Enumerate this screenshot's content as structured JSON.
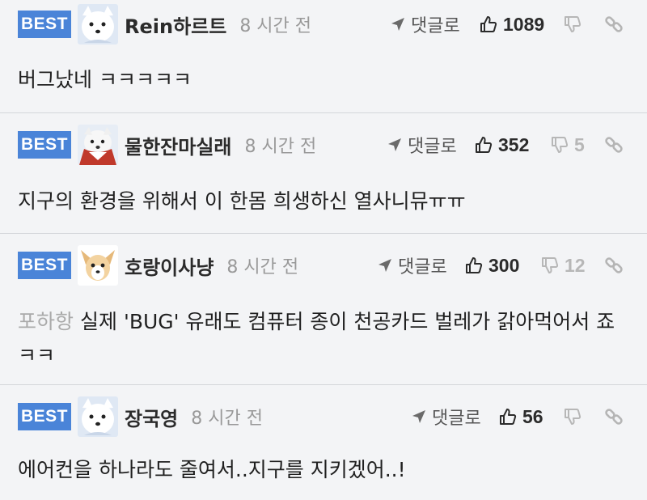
{
  "comments": [
    {
      "badge": "BEST",
      "avatar": "white-dog-avatar",
      "nickname": "Rein하르트",
      "time": "8 시간 전",
      "reply_label": "댓글로",
      "upvotes": "1089",
      "downvotes": "",
      "mention": "",
      "text": "버그났네 ㅋㅋㅋㅋㅋ"
    },
    {
      "badge": "BEST",
      "avatar": "dog-red-cape-avatar",
      "nickname": "물한잔마실래",
      "time": "8 시간 전",
      "reply_label": "댓글로",
      "upvotes": "352",
      "downvotes": "5",
      "mention": "",
      "text": "지구의 환경을 위해서 이 한몸 희생하신 열사니뮤ㅠㅠ"
    },
    {
      "badge": "BEST",
      "avatar": "chihuahua-avatar",
      "nickname": "호랑이사냥",
      "time": "8 시간 전",
      "reply_label": "댓글로",
      "upvotes": "300",
      "downvotes": "12",
      "mention": "포하항",
      "text": "실제 'BUG' 유래도 컴퓨터 종이 천공카드 벌레가 갉아먹어서 죠 ㅋㅋ"
    },
    {
      "badge": "BEST",
      "avatar": "white-dog-avatar",
      "nickname": "장국영",
      "time": "8 시간 전",
      "reply_label": "댓글로",
      "upvotes": "56",
      "downvotes": "",
      "mention": "",
      "text": "에어컨을 하나라도 줄여서..지구를 지키겠어..!"
    }
  ],
  "colors": {
    "best_badge": "#4a84d8",
    "background": "#f3f4f6",
    "time_text": "#999999",
    "mention_text": "#aaaaaa",
    "downvote_text": "#b7b7b7"
  }
}
